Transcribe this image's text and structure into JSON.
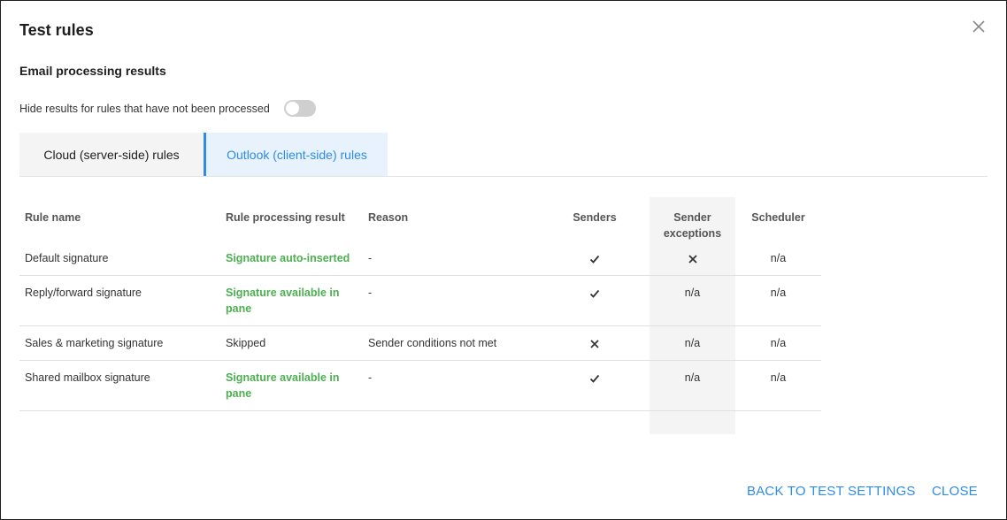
{
  "dialog": {
    "title": "Test rules",
    "subtitle": "Email processing results",
    "toggle_label": "Hide results for rules that have not been processed",
    "toggle_on": false
  },
  "tabs": [
    {
      "label": "Cloud (server-side) rules",
      "active": false
    },
    {
      "label": "Outlook (client-side) rules",
      "active": true
    }
  ],
  "table": {
    "headers": {
      "rule_name": "Rule name",
      "result": "Rule processing result",
      "reason": "Reason",
      "senders": "Senders",
      "sender_exceptions": "Sender exceptions",
      "scheduler": "Scheduler"
    },
    "rows": [
      {
        "rule_name": "Default signature",
        "result": "Signature auto-inserted",
        "result_status": "success",
        "reason": "-",
        "senders": "check-icon",
        "sender_exceptions": "cross-icon",
        "scheduler": "n/a"
      },
      {
        "rule_name": "Reply/forward signature",
        "result": "Signature available in pane",
        "result_status": "success",
        "reason": "-",
        "senders": "check-icon",
        "sender_exceptions": "n/a",
        "scheduler": "n/a"
      },
      {
        "rule_name": "Sales & marketing signature",
        "result": "Skipped",
        "result_status": "skipped",
        "reason": "Sender conditions not met",
        "senders": "cross-icon",
        "sender_exceptions": "n/a",
        "scheduler": "n/a"
      },
      {
        "rule_name": "Shared mailbox signature",
        "result": "Signature available in pane",
        "result_status": "success",
        "reason": "-",
        "senders": "check-icon",
        "sender_exceptions": "n/a",
        "scheduler": "n/a"
      }
    ]
  },
  "footer": {
    "back_label": "BACK TO TEST SETTINGS",
    "close_label": "CLOSE"
  },
  "colors": {
    "accent": "#2e8be6",
    "success": "#4caf50"
  }
}
